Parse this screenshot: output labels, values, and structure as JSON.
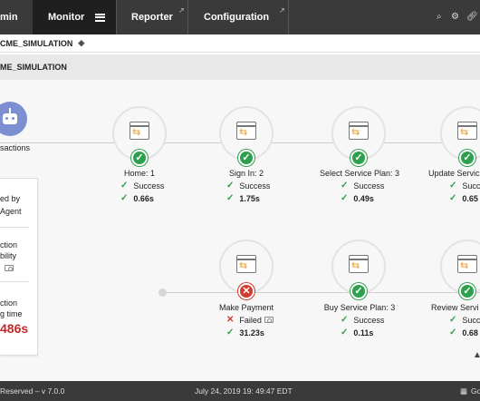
{
  "nav": {
    "admin": "min",
    "monitor": "Monitor",
    "reporter": "Reporter",
    "configuration": "Configuration"
  },
  "breadcrumb": "CME_SIMULATION",
  "section_title": "ME_SIMULATION",
  "left": {
    "transactions_label": "sactions",
    "executed_by_1": "ed by",
    "executed_by_2": "Agent",
    "availability_1": "ction",
    "availability_2": "bility",
    "response_1": "ction",
    "response_2": "g time",
    "response_value": "486s"
  },
  "steps_row1": [
    {
      "label": "Home: 1",
      "status": "Success",
      "time": "0.66s"
    },
    {
      "label": "Sign In: 2",
      "status": "Success",
      "time": "1.75s"
    },
    {
      "label": "Select Service Plan: 3",
      "status": "Success",
      "time": "0.49s"
    },
    {
      "label": "Update Servic",
      "status": "Succe",
      "time": "0.65"
    }
  ],
  "steps_row2": [
    {
      "label": "Make Payment",
      "status": "Failed",
      "time": "31.23s"
    },
    {
      "label": "Buy Service Plan: 3",
      "status": "Success",
      "time": "0.11s"
    },
    {
      "label": "Review Servi",
      "status": "Succ",
      "time": "0.68"
    }
  ],
  "footer": {
    "rights": "Reserved – v 7.0.0",
    "timestamp": "July 24, 2019  19: 49:47 EDT",
    "right": "Go"
  },
  "colors": {
    "success": "#2e9e4f",
    "failure": "#d23b2f",
    "nav_bg": "#3a3a3a",
    "robot": "#7d8fd0"
  }
}
